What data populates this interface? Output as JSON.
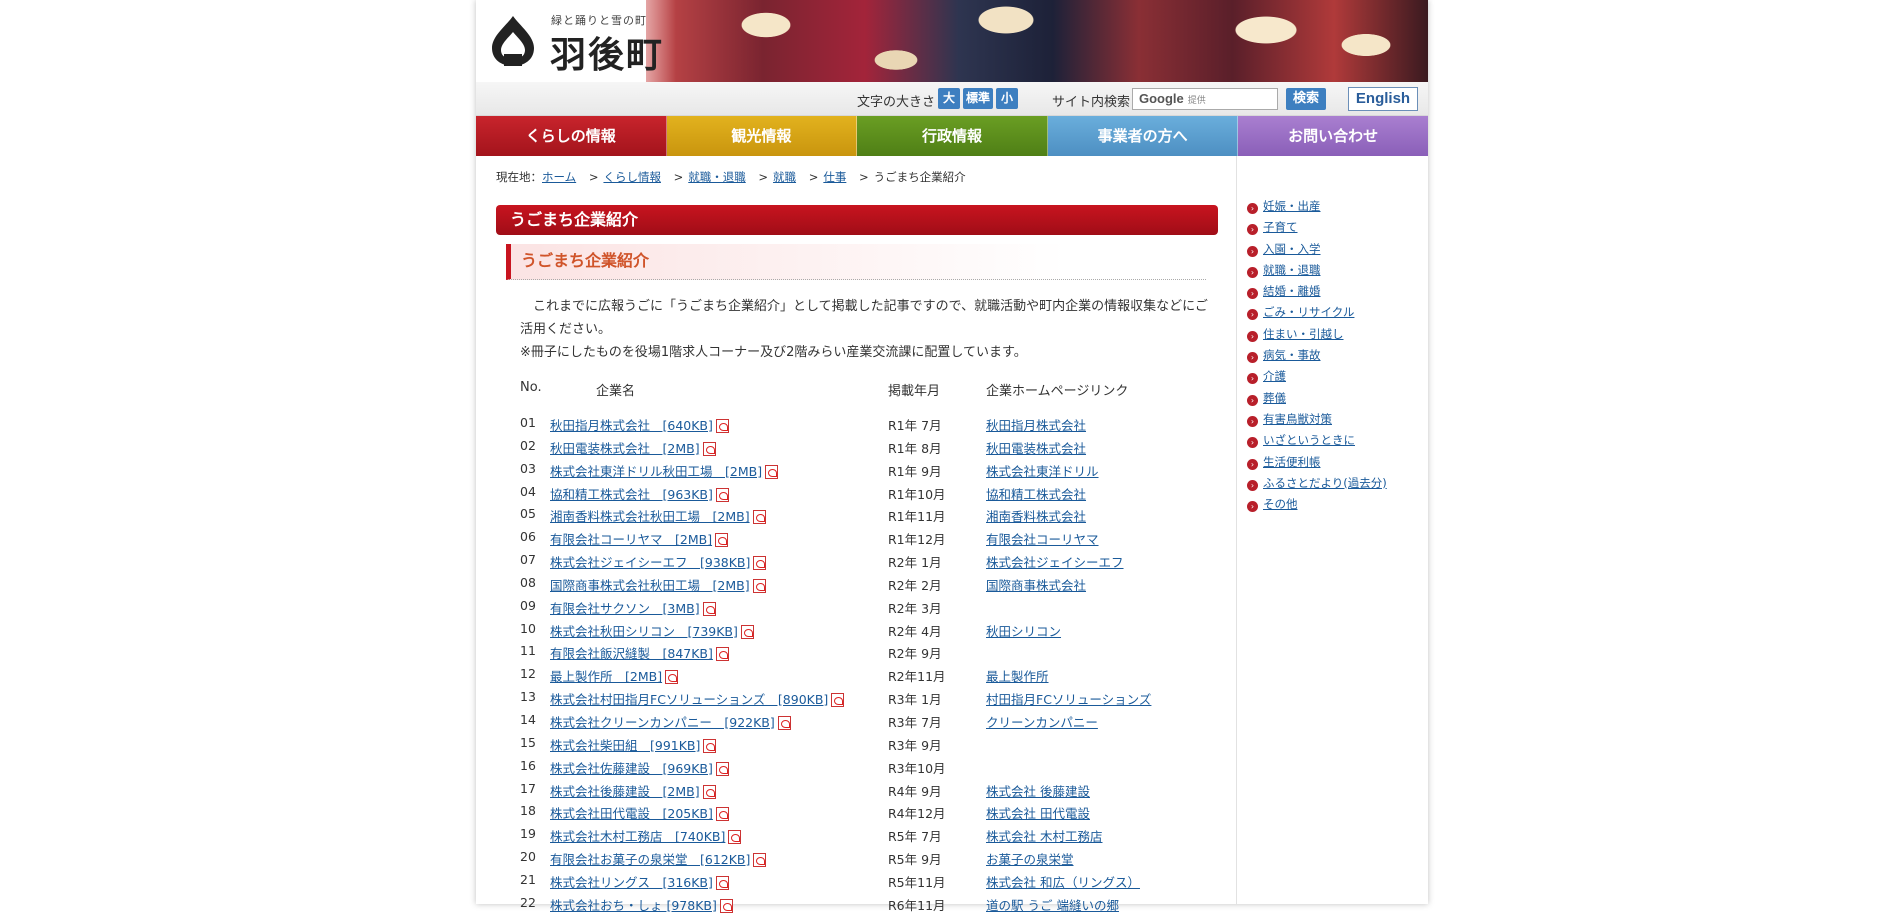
{
  "header": {
    "tagline": "緑と踊りと雪の町",
    "town_name": "羽後町"
  },
  "toolbar": {
    "font_size_label": "文字の大きさ",
    "size_large": "大",
    "size_normal": "標準",
    "size_small": "小",
    "site_search_label": "サイト内検索",
    "search_placeholder_brand": "Google",
    "search_placeholder_suffix": "提供",
    "search_button": "検索",
    "english_button": "English"
  },
  "nav": {
    "items": [
      {
        "label": "くらしの情報",
        "color": "#b91922"
      },
      {
        "label": "観光情報",
        "color": "#d9a516"
      },
      {
        "label": "行政情報",
        "color": "#5b8f1c"
      },
      {
        "label": "事業者の方へ",
        "color": "#5b9ecf"
      },
      {
        "label": "お問い合わせ",
        "color": "#9b6fc4"
      }
    ]
  },
  "breadcrumb": {
    "prefix": "現在地：",
    "items": [
      "ホーム",
      "くらし情報",
      "就職・退職",
      "就職",
      "仕事"
    ],
    "current": "うごまち企業紹介"
  },
  "page": {
    "title": "うごまち企業紹介",
    "subtitle": "うごまち企業紹介",
    "intro_line1": "　これまでに広報うごに「うごまち企業紹介」として掲載した記事ですので、就職活動や町内企業の情報収集などにご活用ください。",
    "intro_line2": "※冊子にしたものを役場1階求人コーナー及び2階みらい産業交流課に配置しています。"
  },
  "table": {
    "headers": {
      "no": "No.",
      "name": "企業名",
      "date": "掲載年月",
      "link": "企業ホームページリンク"
    },
    "rows": [
      {
        "no": "01",
        "name": "秋田指月株式会社　[640KB]",
        "date": "R1年 7月",
        "link": "秋田指月株式会社"
      },
      {
        "no": "02",
        "name": "秋田電装株式会社　[2MB]",
        "date": "R1年 8月",
        "link": "秋田電装株式会社"
      },
      {
        "no": "03",
        "name": "株式会社東洋ドリル秋田工場　[2MB]",
        "date": "R1年 9月",
        "link": "株式会社東洋ドリル"
      },
      {
        "no": "04",
        "name": "協和精工株式会社　[963KB]",
        "date": "R1年10月",
        "link": "協和精工株式会社"
      },
      {
        "no": "05",
        "name": "湘南香料株式会社秋田工場　[2MB]",
        "date": "R1年11月",
        "link": "湘南香料株式会社"
      },
      {
        "no": "06",
        "name": "有限会社コーリヤマ　[2MB]",
        "date": "R1年12月",
        "link": "有限会社コーリヤマ"
      },
      {
        "no": "07",
        "name": "株式会社ジェイシーエフ　[938KB]",
        "date": "R2年 1月",
        "link": "株式会社ジェイシーエフ"
      },
      {
        "no": "08",
        "name": "国際商事株式会社秋田工場　[2MB]",
        "date": "R2年 2月",
        "link": "国際商事株式会社"
      },
      {
        "no": "09",
        "name": "有限会社サクソン　[3MB]",
        "date": "R2年 3月",
        "link": ""
      },
      {
        "no": "10",
        "name": "株式会社秋田シリコン　[739KB]",
        "date": "R2年 4月",
        "link": "秋田シリコン"
      },
      {
        "no": "11",
        "name": "有限会社飯沢縫製　[847KB]",
        "date": "R2年 9月",
        "link": ""
      },
      {
        "no": "12",
        "name": "最上製作所　[2MB]",
        "date": "R2年11月",
        "link": "最上製作所"
      },
      {
        "no": "13",
        "name": "株式会社村田指月FCソリューションズ　[890KB]",
        "date": "R3年 1月",
        "link": "村田指月FCソリューションズ"
      },
      {
        "no": "14",
        "name": "株式会社クリーンカンパニー　[922KB]",
        "date": "R3年 7月",
        "link": "クリーンカンパニー"
      },
      {
        "no": "15",
        "name": "株式会社柴田組　[991KB]",
        "date": "R3年 9月",
        "link": ""
      },
      {
        "no": "16",
        "name": "株式会社佐藤建設　[969KB]",
        "date": "R3年10月",
        "link": ""
      },
      {
        "no": "17",
        "name": "株式会社後藤建設　[2MB]",
        "date": "R4年 9月",
        "link": "株式会社 後藤建設"
      },
      {
        "no": "18",
        "name": "株式会社田代電設　[205KB]",
        "date": "R4年12月",
        "link": "株式会社 田代電設"
      },
      {
        "no": "19",
        "name": "株式会社木村工務店　[740KB]",
        "date": "R5年 7月",
        "link": "株式会社 木村工務店"
      },
      {
        "no": "20",
        "name": "有限会社お菓子の泉栄堂　[612KB]",
        "date": "R5年 9月",
        "link": "お菓子の泉栄堂"
      },
      {
        "no": "21",
        "name": "株式会社リングス　[316KB]",
        "date": "R5年11月",
        "link": "株式会社 和広（リングス）"
      },
      {
        "no": "22",
        "name": "株式会社おち・しょ [978KB]",
        "date": "R6年11月",
        "link": "道の駅 うご 端縫いの郷"
      }
    ]
  },
  "sidebar": {
    "items": [
      "妊娠・出産",
      "子育て",
      "入園・入学",
      "就職・退職",
      "結婚・離婚",
      "ごみ・リサイクル",
      "住まい・引越し",
      "病気・事故",
      "介護",
      "葬儀",
      "有害鳥獣対策",
      "いざというときに",
      "生活便利帳",
      "ふるさとだより(過去分)",
      "その他"
    ]
  }
}
